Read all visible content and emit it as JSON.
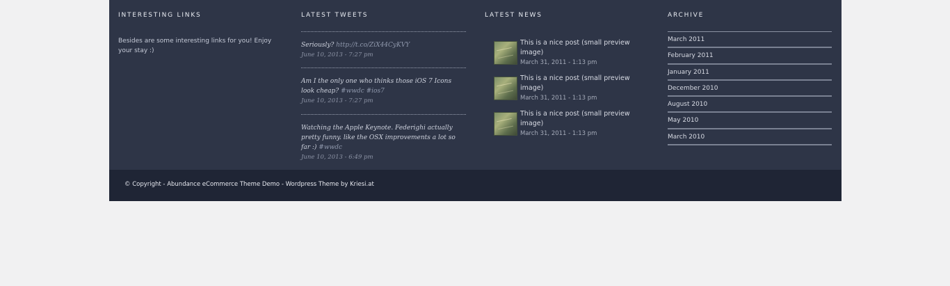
{
  "links": {
    "title": "INTERESTING LINKS",
    "text": "Besides are some interesting links for you! Enjoy your stay :)"
  },
  "tweets": {
    "title": "LATEST TWEETS",
    "items": [
      {
        "text": "Seriously?",
        "link": "http://t.co/ZiX44CyKVY",
        "date": "June 10, 2013 - 7:27 pm"
      },
      {
        "text": "Am I the only one who thinks those iOS 7 Icons look cheap?",
        "link": "#wwdc #ios7",
        "date": "June 10, 2013 - 7:27 pm"
      },
      {
        "text": "Watching the Apple Keynote. Federighi actually pretty funny. like the OSX improvements a lot so far :)",
        "link": "#wwdc",
        "date": "June 10, 2013 - 6:49 pm"
      }
    ]
  },
  "news": {
    "title": "LATEST NEWS",
    "items": [
      {
        "title": "This is a nice post (small preview image)",
        "date": "March 31, 2011 - 1:13 pm"
      },
      {
        "title": "This is a nice post (small preview image)",
        "date": "March 31, 2011 - 1:13 pm"
      },
      {
        "title": "This is a nice post (small preview image)",
        "date": "March 31, 2011 - 1:13 pm"
      }
    ]
  },
  "archive": {
    "title": "ARCHIVE",
    "items": [
      "March 2011",
      "February 2011",
      "January 2011",
      "December 2010",
      "August 2010",
      "May 2010",
      "March 2010"
    ]
  },
  "copyright": {
    "text": "© Copyright - Abundance eCommerce Theme Demo - Wordpress Theme by Kriesi.at"
  }
}
